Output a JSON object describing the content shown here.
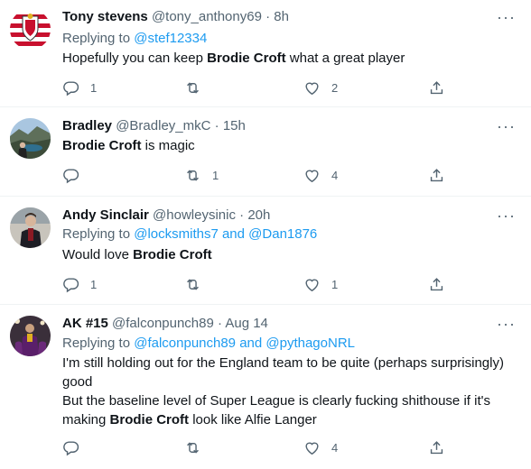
{
  "tweets": [
    {
      "name": "Tony stevens",
      "handle": "@tony_anthony69",
      "sep": "·",
      "time": "8h",
      "replying_prefix": "Replying to",
      "mentions": "@stef12334",
      "text_before": "Hopefully you can keep ",
      "highlight": "Brodie Croft",
      "text_after": " what a great player",
      "reply_count": "1",
      "retweet_count": "",
      "like_count": "2"
    },
    {
      "name": "Bradley",
      "handle": "@Bradley_mkC",
      "sep": "·",
      "time": "15h",
      "highlight": "Brodie Croft",
      "text_after": " is magic",
      "reply_count": "",
      "retweet_count": "1",
      "like_count": "4"
    },
    {
      "name": "Andy Sinclair",
      "handle": "@howleysinic",
      "sep": "·",
      "time": "20h",
      "replying_prefix": "Replying to",
      "mentions": "@locksmiths7 and @Dan1876",
      "text_before": "Would love ",
      "highlight": "Brodie Croft",
      "reply_count": "1",
      "retweet_count": "",
      "like_count": "1"
    },
    {
      "name": "AK #15",
      "handle": "@falconpunch89",
      "sep": "·",
      "time": "Aug 14",
      "replying_prefix": "Replying to",
      "mentions": "@falconpunch89 and @pythagoNRL",
      "line1": "I'm still holding out for the England team to be quite (perhaps surprisingly)",
      "line2": "good",
      "line3": "But the baseline level of Super League is clearly fucking shithouse if it's",
      "line4_before": "making ",
      "highlight": "Brodie Croft",
      "line4_after": " look like Alfie Langer",
      "reply_count": "",
      "retweet_count": "",
      "like_count": "4"
    }
  ],
  "colors": {
    "link": "#1d9bf0",
    "secondary": "#536471",
    "text": "#0f1419",
    "divider": "#eff3f4"
  },
  "icons": {
    "reply": "reply-icon",
    "retweet": "retweet-icon",
    "like": "heart-icon",
    "share": "share-icon",
    "more": "more-icon"
  }
}
